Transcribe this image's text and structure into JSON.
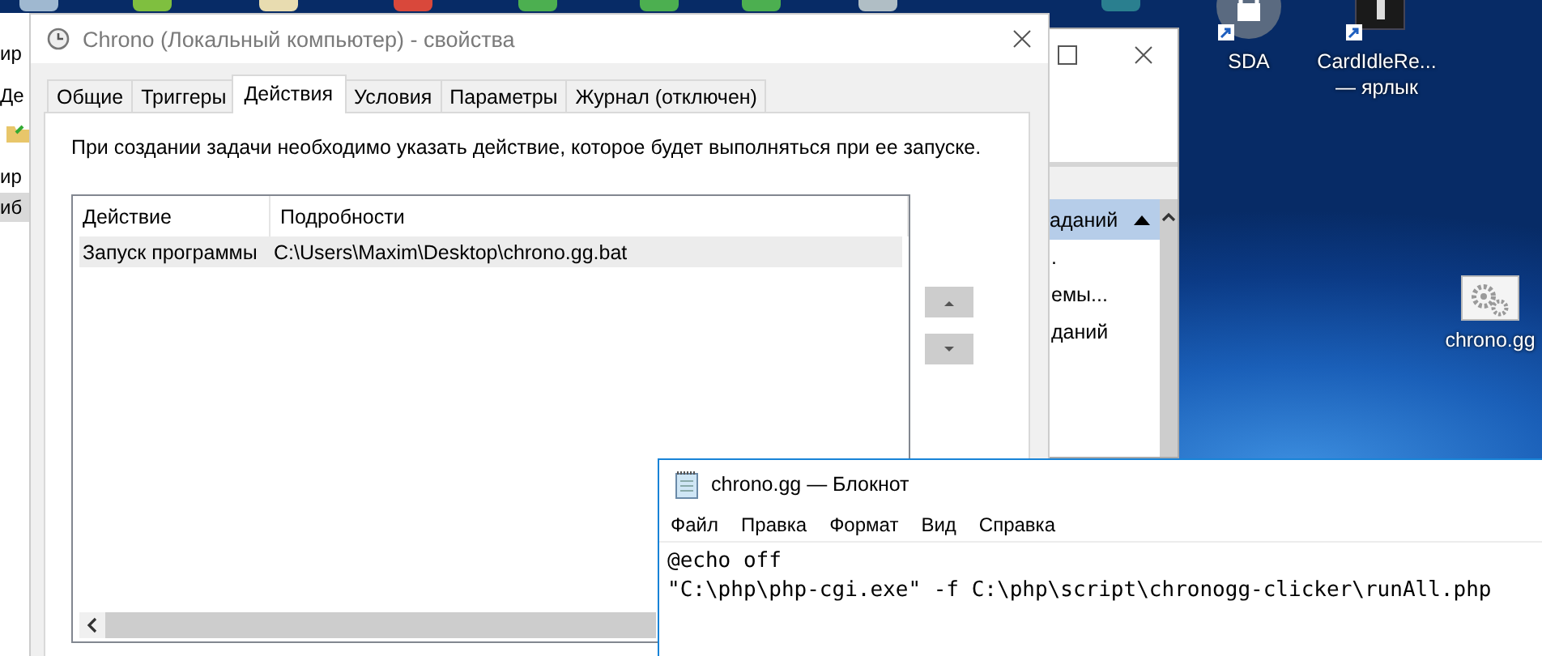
{
  "left_window": {
    "fragments": [
      "ир",
      "Де",
      "ир",
      "иб"
    ]
  },
  "scheduler_window": {
    "column_header": "аданий",
    "items": [
      ".",
      "емы...",
      "даний"
    ]
  },
  "desktop_icons": [
    {
      "kind": "lock",
      "label_lines": [
        "SDA"
      ]
    },
    {
      "kind": "info",
      "label_lines": [
        "CardIdleRe...",
        "— ярлык"
      ]
    },
    {
      "kind": "gears",
      "label_lines": [
        "chrono.gg"
      ]
    }
  ],
  "properties_dialog": {
    "title": "Chrono (Локальный компьютер) - свойства",
    "tabs": [
      {
        "label": "Общие",
        "selected": false
      },
      {
        "label": "Триггеры",
        "selected": false
      },
      {
        "label": "Действия",
        "selected": true
      },
      {
        "label": "Условия",
        "selected": false
      },
      {
        "label": "Параметры",
        "selected": false
      },
      {
        "label": "Журнал (отключен)",
        "selected": false
      }
    ],
    "description": "При создании задачи необходимо указать действие, которое будет выполняться при ее запуске.",
    "table": {
      "columns": [
        "Действие",
        "Подробности"
      ],
      "rows": [
        {
          "cells": [
            "Запуск программы",
            "C:\\Users\\Maxim\\Desktop\\chrono.gg.bat"
          ],
          "selected": true
        }
      ]
    }
  },
  "notepad": {
    "title": "chrono.gg — Блокнот",
    "menu": [
      "Файл",
      "Правка",
      "Формат",
      "Вид",
      "Справка"
    ],
    "lines": [
      "@echo off",
      "\"C:\\php\\php-cgi.exe\" -f C:\\php\\script\\chronogg-clicker\\runAll.php"
    ]
  }
}
